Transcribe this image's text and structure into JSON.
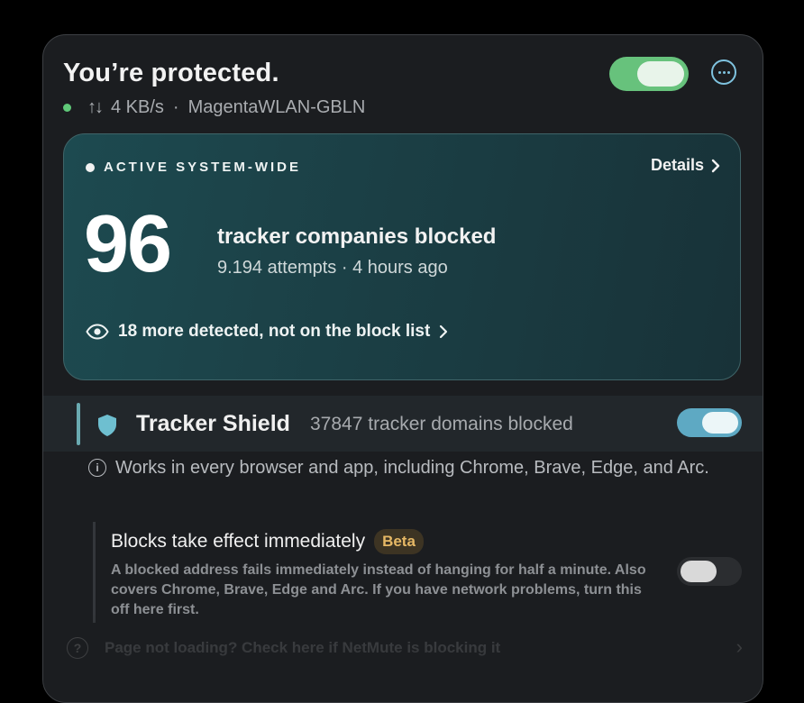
{
  "header": {
    "title": "You’re protected.",
    "speed": "4 KB/s",
    "separator": "·",
    "network": "MagentaWLAN-GBLN"
  },
  "main_toggle": {
    "on": true
  },
  "card": {
    "status": "ACTIVE SYSTEM-WIDE",
    "details_label": "Details",
    "blocked_count": "96",
    "blocked_label": "tracker companies blocked",
    "attempts_line": "9.194 attempts · 4 hours ago",
    "detected_line": "18 more detected, not on the block list"
  },
  "tracker_shield": {
    "name": "Tracker Shield",
    "count_label": "37847 tracker domains blocked",
    "enabled": true,
    "info": "Works in every browser and app, including Chrome, Brave, Edge, and Arc."
  },
  "immediate_blocks": {
    "title": "Blocks take effect immediately",
    "badge": "Beta",
    "description": "A blocked address fails immediately instead of hanging for half a minute. Also covers Chrome, Brave, Edge and Arc. If you have network problems, turn this off here first.",
    "enabled": false
  },
  "help_row": {
    "text": "Page not loading? Check here if NetMute is blocking it"
  },
  "colors": {
    "accent_green": "#67c27c",
    "accent_teal": "#5ea9c3",
    "beta": "#e6b865"
  }
}
